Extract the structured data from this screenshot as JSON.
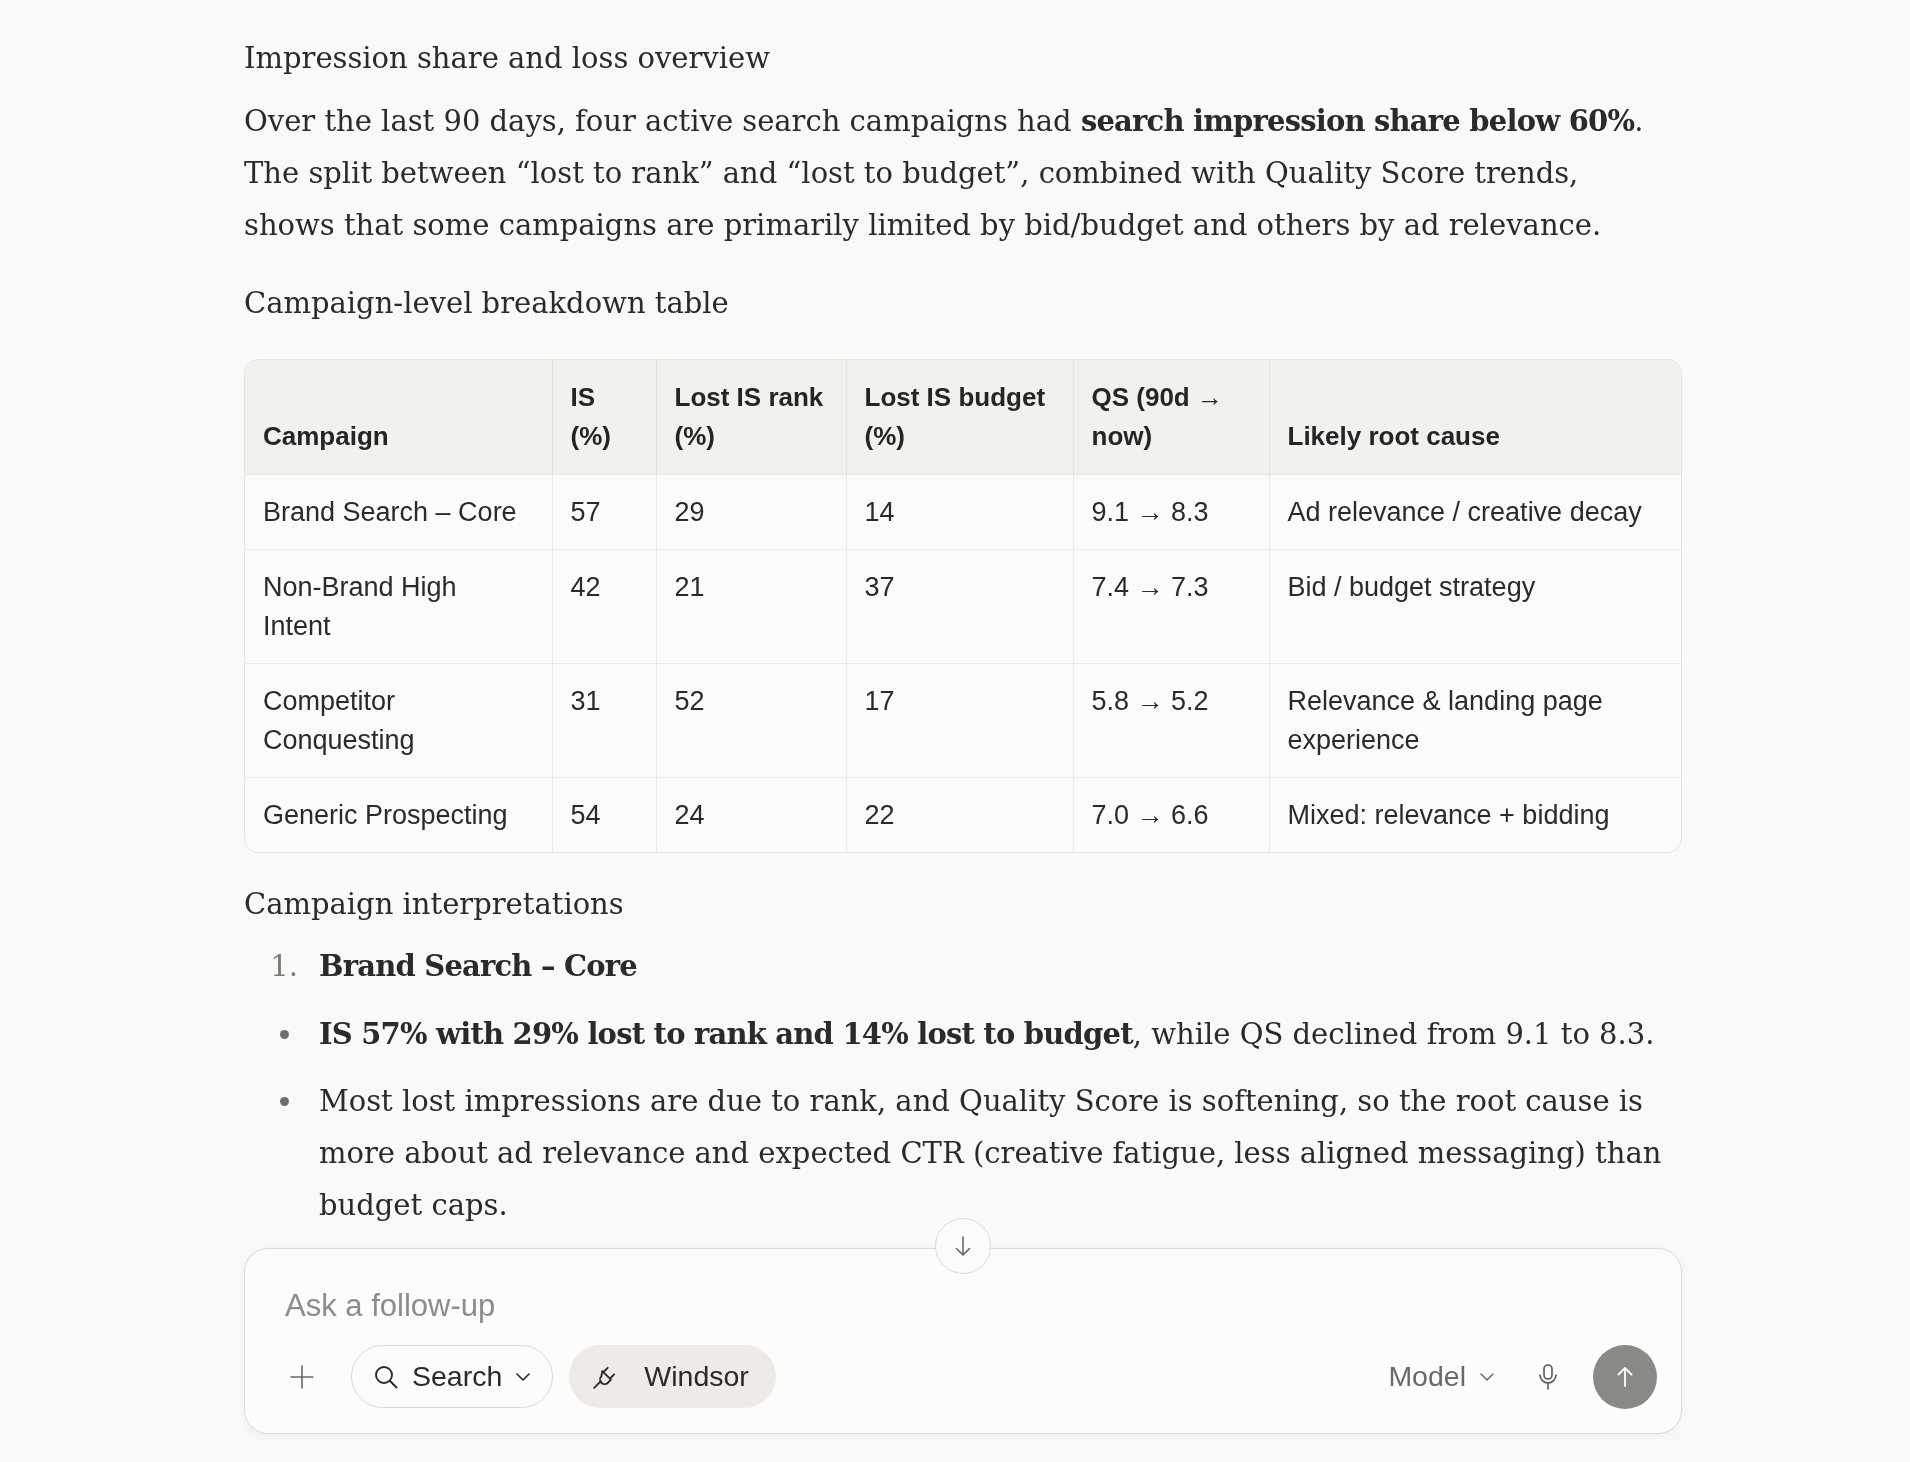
{
  "overview": {
    "heading": "Impression share and loss overview",
    "paragraph": "Over the last 90 days, four active search campaigns had **search impression share below 60%**. The split between “lost to rank” and “lost to budget”, combined with Quality Score trends, shows that some campaigns are primarily limited by bid/budget and others by ad relevance."
  },
  "breakdown": {
    "heading": "Campaign-level breakdown table",
    "table": {
      "columns": [
        "Campaign",
        "IS (%)",
        "Lost IS rank (%)",
        "Lost IS budget (%)",
        "QS (90d → now)",
        "Likely root cause"
      ],
      "rows": [
        [
          "Brand Search – Core",
          "57",
          "29",
          "14",
          "9.1 → 8.3",
          "Ad relevance / creative decay"
        ],
        [
          "Non-Brand High Intent",
          "42",
          "21",
          "37",
          "7.4 → 7.3",
          "Bid / budget strategy"
        ],
        [
          "Competitor Conquesting",
          "31",
          "52",
          "17",
          "5.8 → 5.2",
          "Relevance & landing page experience"
        ],
        [
          "Generic Prospecting",
          "54",
          "24",
          "22",
          "7.0 → 6.6",
          "Mixed: relevance + bidding"
        ]
      ]
    }
  },
  "interpretations": {
    "heading": "Campaign interpretations",
    "numbered": [
      {
        "number": "1.",
        "title": "Brand Search – Core"
      }
    ],
    "bullets": [
      "**IS 57% with 29% lost to rank and 14% lost to budget**, while QS declined from 9.1 to 8.3.",
      "Most lost impressions are due to rank, and Quality Score is softening, so the root cause is more about ad relevance and expected CTR (creative fatigue, less aligned messaging) than budget caps."
    ]
  },
  "composer": {
    "placeholder": "Ask a follow-up",
    "tools": [
      {
        "kind": "search",
        "label": "Search",
        "selected": false
      },
      {
        "kind": "connector",
        "label": "Windsor",
        "selected": true
      }
    ],
    "model": "Model"
  }
}
